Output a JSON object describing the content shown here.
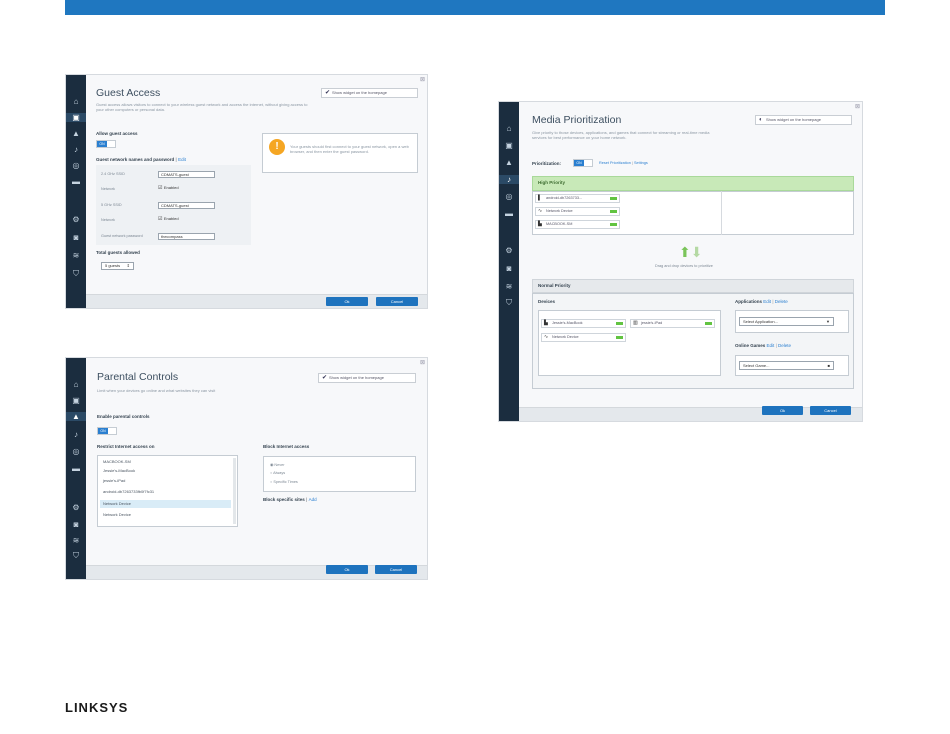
{
  "brand": {
    "logo": "LINKSYS",
    "accent": "#1f77c0",
    "rail": "#1b2d3f",
    "high_priority_green": "#c8e9b8"
  },
  "guest": {
    "title": "Guest Access",
    "description": "Guest access allows visitors to connect to your wireless guest network and access the internet, without giving access to your other computers or personal data.",
    "show_widget": "Show widget on the homepage",
    "allow_label": "Allow guest access",
    "toggle_on": "ON",
    "names_label": "Guest network names and password",
    "names_edit": "Edit",
    "ghz24_label": "2.4 GHz SSID",
    "ghz24_value": "CDMATS-guest",
    "network_label": "Network",
    "enabled": "Enabled",
    "ghz5_label": "5 GHz SSID",
    "ghz5_value": "CDMATS-guest",
    "network2_label": "Network",
    "password_label": "Guest network password",
    "password_value": "thecompass",
    "total_label": "Total guests allowed",
    "total_value": "5 guests",
    "info_text": "Your guests should first connect to your guest network, open a web browser, and then enter the guest password.",
    "ok": "Ok",
    "cancel": "Cancel"
  },
  "parental": {
    "title": "Parental Controls",
    "description": "Limit when your devices go online and what websites they can visit",
    "show_widget": "Show widget on the homepage",
    "enable_label": "Enable parental controls",
    "toggle_on": "ON",
    "restrict_label": "Restrict Internet access on",
    "devices": [
      "MACBOOK-SM",
      "Jessie's-MacBook",
      "jessie's-iPad",
      "android-db7263733fb0f7fc31",
      "Network Device",
      "Network Device"
    ],
    "block_label": "Block Internet access",
    "radio_options": [
      "Never",
      "Always",
      "Specific Times"
    ],
    "block_sites_label": "Block specific sites",
    "block_sites_edit": "Add",
    "ok": "Ok",
    "cancel": "Cancel"
  },
  "media": {
    "title": "Media Prioritization",
    "description": "Give priority to those devices, applications, and games that connect for streaming or real-time media services for best performance on your home network.",
    "show_widget": "Show widget on the homepage",
    "prioritization_label": "Prioritization:",
    "toggle_on": "ON",
    "reset_link": "Reset Prioritization",
    "settings_link": "Settings",
    "high_priority": "High Priority",
    "high_devices": [
      "android-db7263733...",
      "Network Device",
      "MACBOOK-SM"
    ],
    "drag_hint": "Drag and drop devices to prioritize",
    "normal_priority": "Normal Priority",
    "devices_label": "Devices",
    "normal_devices": [
      "Jessie's-MacBook",
      "jessie's-iPad",
      "Network Device"
    ],
    "applications_label": "Applications",
    "app_edit": "Edit",
    "app_delete": "Delete",
    "app_select": "Select Application...",
    "games_label": "Online Games",
    "games_edit": "Edit",
    "games_delete": "Delete",
    "games_select": "Select Game...",
    "ok": "Ok",
    "cancel": "Cancel"
  }
}
